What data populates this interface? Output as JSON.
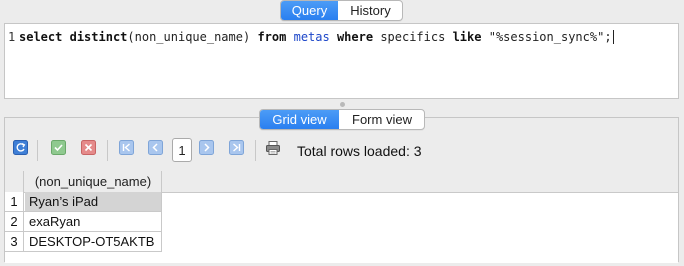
{
  "query_tabs": [
    {
      "label": "Query",
      "active": true
    },
    {
      "label": "History",
      "active": false
    }
  ],
  "editor": {
    "line_number": "1",
    "tokens": {
      "kw_select": "select",
      "kw_distinct": "distinct",
      "expr": "(non_unique_name)",
      "kw_from": "from",
      "table": "metas",
      "kw_where": "where",
      "column": "specifics",
      "kw_like": "like",
      "pattern": "\"%session_sync%\";"
    }
  },
  "view_tabs": [
    {
      "label": "Grid view",
      "active": true
    },
    {
      "label": "Form view",
      "active": false
    }
  ],
  "toolbar": {
    "icons": [
      "refresh-icon",
      "commit-check-icon",
      "rollback-x-icon",
      "first-page-icon",
      "prev-page-icon",
      "next-page-icon",
      "last-page-icon",
      "print-icon"
    ],
    "page_number": "1",
    "rows_loaded_label": "Total rows loaded: 3"
  },
  "grid": {
    "columns": [
      "(non_unique_name)"
    ],
    "rows": [
      {
        "num": "1",
        "non_unique_name": "Ryan’s iPad",
        "selected": true
      },
      {
        "num": "2",
        "non_unique_name": "exaRyan",
        "selected": false
      },
      {
        "num": "3",
        "non_unique_name": "DESKTOP-OT5AKTB",
        "selected": false
      }
    ]
  },
  "colors": {
    "accent": "#2a7ff0",
    "table_name": "#1c46c9",
    "background": "#ececec"
  }
}
